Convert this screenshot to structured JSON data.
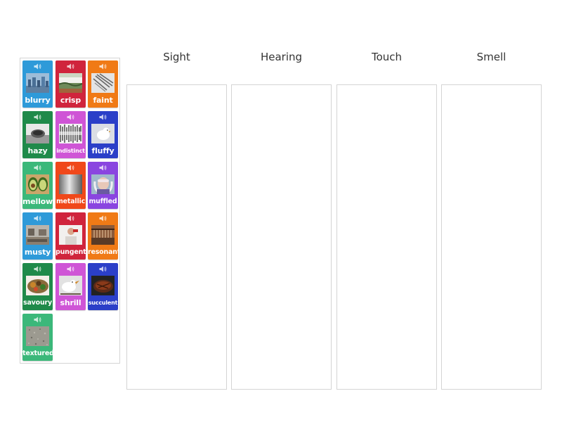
{
  "categories": [
    {
      "label": "Sight"
    },
    {
      "label": "Hearing"
    },
    {
      "label": "Touch"
    },
    {
      "label": "Smell"
    }
  ],
  "cards": [
    {
      "label": "blurry",
      "color": "#2e9ad9",
      "icon": "speaker-icon"
    },
    {
      "label": "crisp",
      "color": "#d0243c",
      "icon": "speaker-icon"
    },
    {
      "label": "faint",
      "color": "#f07a16",
      "icon": "speaker-icon"
    },
    {
      "label": "hazy",
      "color": "#1f8a4a",
      "icon": "speaker-icon"
    },
    {
      "label": "indistinct",
      "color": "#cf55d6",
      "icon": "speaker-icon"
    },
    {
      "label": "fluffy",
      "color": "#2b3fc8",
      "icon": "speaker-icon"
    },
    {
      "label": "mellow",
      "color": "#3bb87a",
      "icon": "speaker-icon"
    },
    {
      "label": "metallic",
      "color": "#f0481a",
      "icon": "speaker-icon"
    },
    {
      "label": "muffled",
      "color": "#8a45e0",
      "icon": "speaker-icon"
    },
    {
      "label": "musty",
      "color": "#2e9ad9",
      "icon": "speaker-icon"
    },
    {
      "label": "pungent",
      "color": "#d0243c",
      "icon": "speaker-icon"
    },
    {
      "label": "resonant",
      "color": "#f07a16",
      "icon": "speaker-icon"
    },
    {
      "label": "savoury",
      "color": "#1f8a4a",
      "icon": "speaker-icon"
    },
    {
      "label": "shrill",
      "color": "#cf55d6",
      "icon": "speaker-icon"
    },
    {
      "label": "succulent",
      "color": "#2b3fc8",
      "icon": "speaker-icon"
    },
    {
      "label": "textured",
      "color": "#3bb87a",
      "icon": "speaker-icon"
    }
  ]
}
